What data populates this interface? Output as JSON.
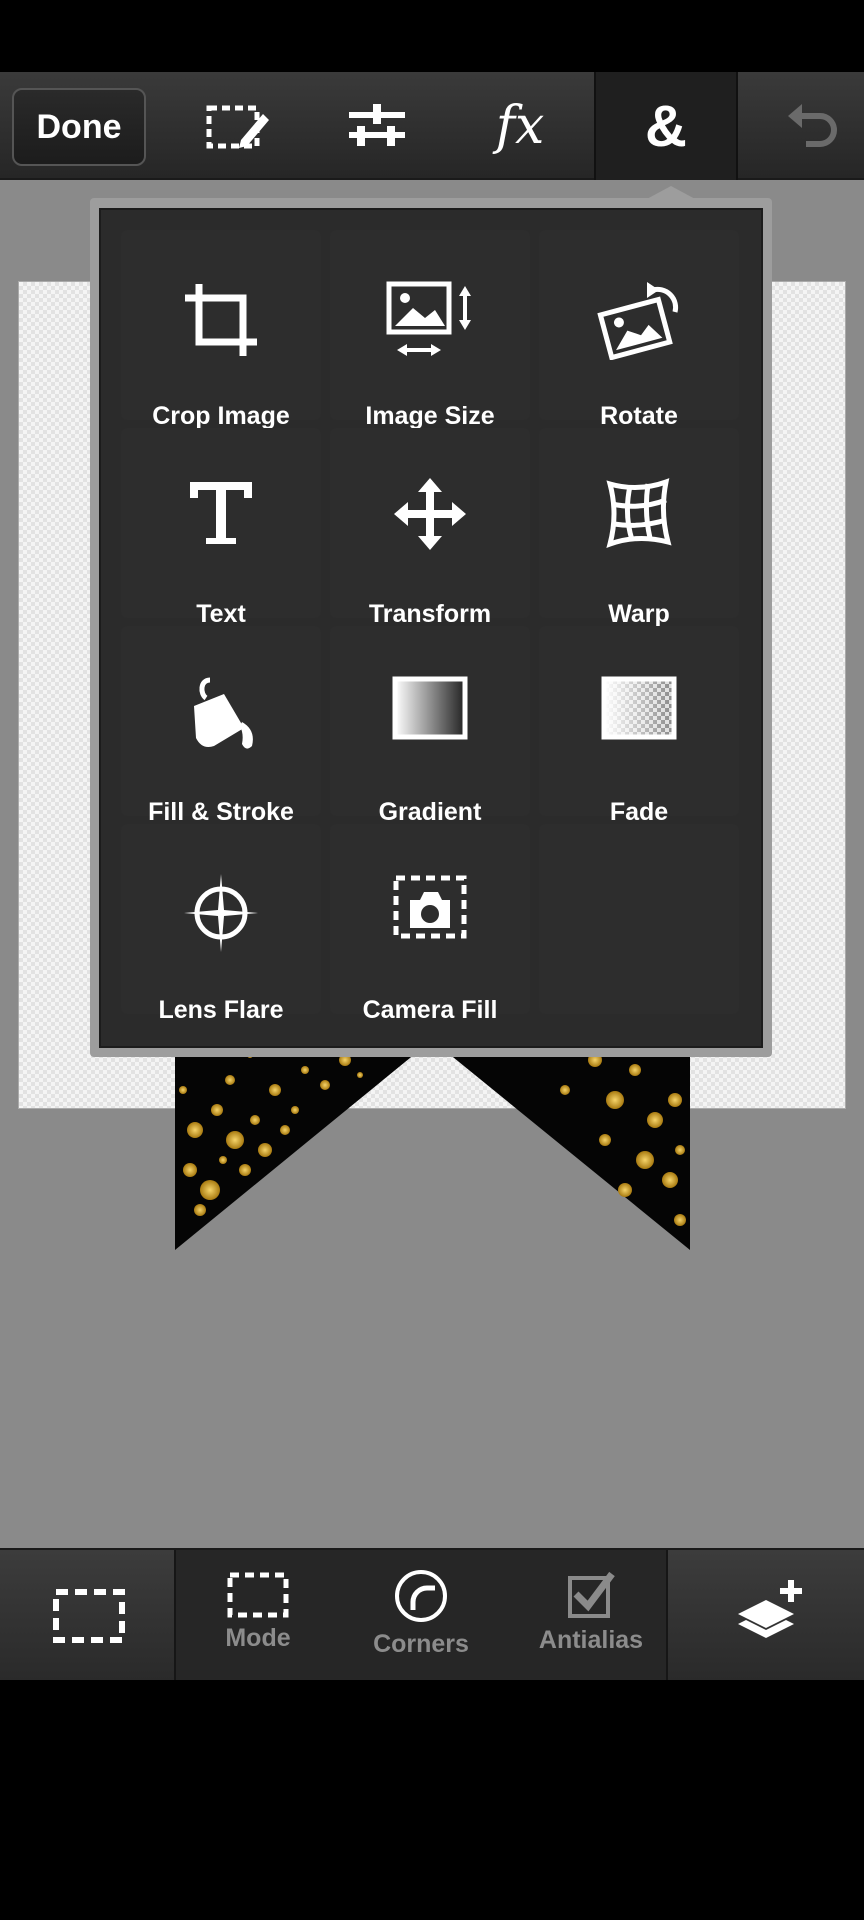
{
  "toolbar": {
    "done_label": "Done",
    "icons": [
      "selection-edit-icon",
      "adjustments-icon",
      "fx-icon",
      "ampersand-icon",
      "undo-icon"
    ],
    "fx_glyph": "fx",
    "amp_glyph": "&"
  },
  "menu": {
    "items": [
      {
        "label": "Crop Image",
        "icon": "crop-icon"
      },
      {
        "label": "Image Size",
        "icon": "image-size-icon"
      },
      {
        "label": "Rotate",
        "icon": "rotate-icon"
      },
      {
        "label": "Text",
        "icon": "text-icon"
      },
      {
        "label": "Transform",
        "icon": "transform-icon"
      },
      {
        "label": "Warp",
        "icon": "warp-icon"
      },
      {
        "label": "Fill & Stroke",
        "icon": "paint-bucket-icon"
      },
      {
        "label": "Gradient",
        "icon": "gradient-icon"
      },
      {
        "label": "Fade",
        "icon": "fade-icon"
      },
      {
        "label": "Lens Flare",
        "icon": "lens-flare-icon"
      },
      {
        "label": "Camera Fill",
        "icon": "camera-fill-icon"
      }
    ]
  },
  "bottom": {
    "mode_label": "Mode",
    "corners_label": "Corners",
    "antialias_label": "Antialias"
  },
  "colors": {
    "toolbar": "#2e2e2e",
    "menu_bg": "#2b2b2b",
    "work_area": "#8a8a8a",
    "glitter_gold": "#d4a520"
  }
}
